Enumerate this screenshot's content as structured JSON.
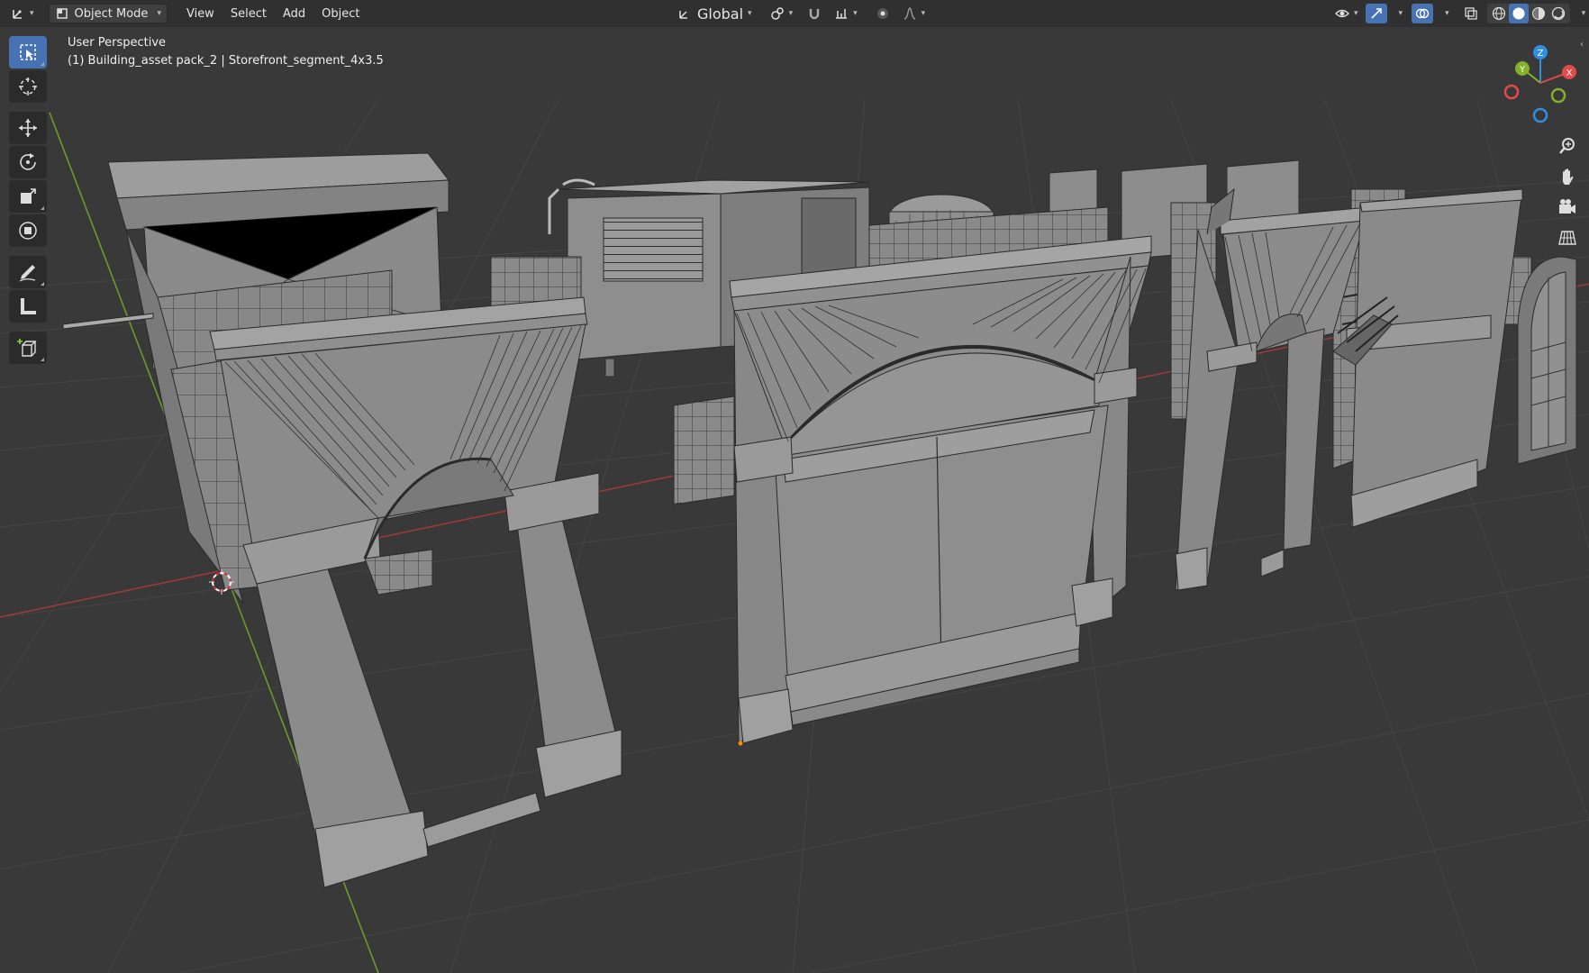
{
  "header": {
    "editor_type_icon": "axes-icon",
    "mode": "Object Mode",
    "menus": [
      "View",
      "Select",
      "Add",
      "Object"
    ],
    "transform_orientation": "Global"
  },
  "viewport": {
    "title": "User Perspective",
    "object_info": "(1) Building_asset pack_2 | Storefront_segment_4x3.5"
  },
  "toolbar": {
    "tools": [
      "select-box-icon",
      "cursor-icon",
      "move-icon",
      "rotate-icon",
      "scale-icon",
      "transform-icon",
      "annotate-icon",
      "measure-icon",
      "add-cube-icon"
    ],
    "active_tool": "select-box-icon"
  },
  "gizmo": {
    "axes": [
      "X",
      "Y",
      "Z"
    ],
    "colors": {
      "x": "#e14b4b",
      "y": "#84b02b",
      "z": "#2f8fe0"
    }
  },
  "colors": {
    "accent": "#4772b3",
    "background": "#393939",
    "header": "#303030",
    "x_axis": "#9b3a3a",
    "y_axis": "#6d9a2c",
    "mesh": "#8c8c8c",
    "wire": "#2a2a2a"
  }
}
